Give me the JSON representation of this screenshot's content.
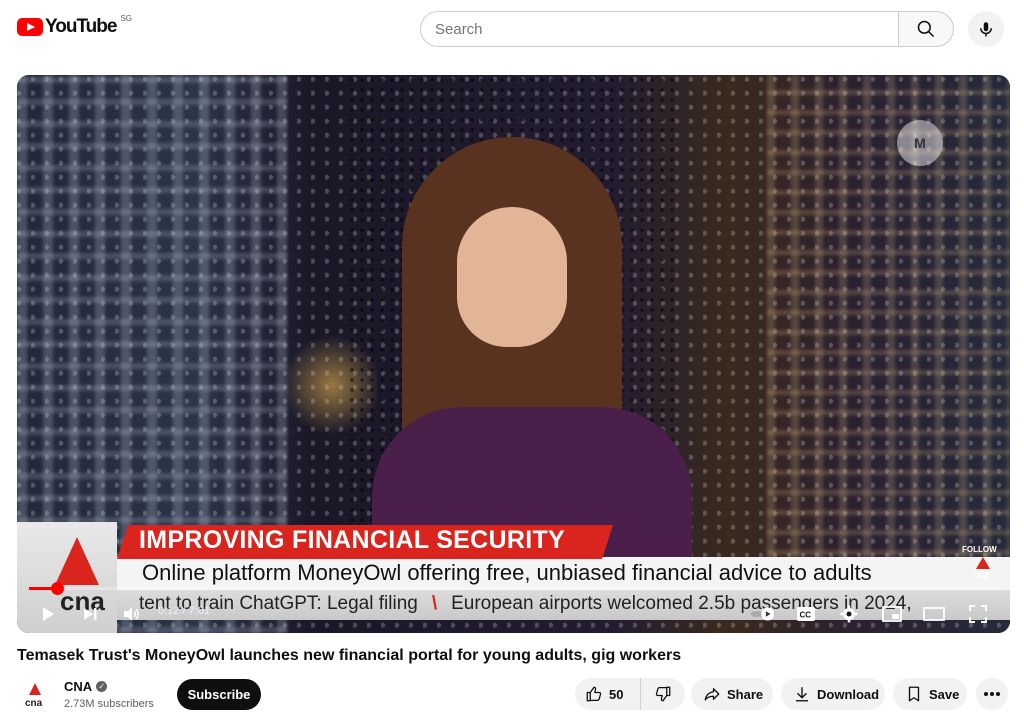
{
  "header": {
    "logo_text": "YouTube",
    "region": "SG",
    "search_placeholder": "Search"
  },
  "video": {
    "overlay": {
      "headline": "IMPROVING FINANCIAL SECURITY",
      "subheadline": "Online platform MoneyOwl offering free, unbiased financial advice to adults",
      "ticker_left": "tent to train ChatGPT: Legal filing",
      "ticker_right": "European airports welcomed 2.5b passengers in 2024,",
      "brand": "cna",
      "follow_label": "FOLLOW",
      "follow_brand": "cna"
    },
    "current_time": "0:12",
    "duration": "7:01",
    "time_display": "0:12 / 7:01",
    "progress_fraction": 0.0285,
    "accent_color": "#ff0000"
  },
  "title": "Temasek Trust's MoneyOwl launches new financial portal for young adults, gig workers",
  "channel": {
    "name": "CNA",
    "subscribers": "2.73M subscribers",
    "avatar_text": "cna",
    "subscribe_label": "Subscribe"
  },
  "actions": {
    "like_count": "50",
    "share_label": "Share",
    "download_label": "Download",
    "save_label": "Save"
  },
  "icons": [
    "search-icon",
    "mic-icon",
    "play-icon",
    "next-icon",
    "volume-icon",
    "autoplay-toggle-icon",
    "captions-icon",
    "settings-icon",
    "miniplayer-icon",
    "theater-icon",
    "fullscreen-icon",
    "verified-icon",
    "like-icon",
    "dislike-icon",
    "share-icon",
    "download-icon",
    "save-icon",
    "more-icon"
  ]
}
